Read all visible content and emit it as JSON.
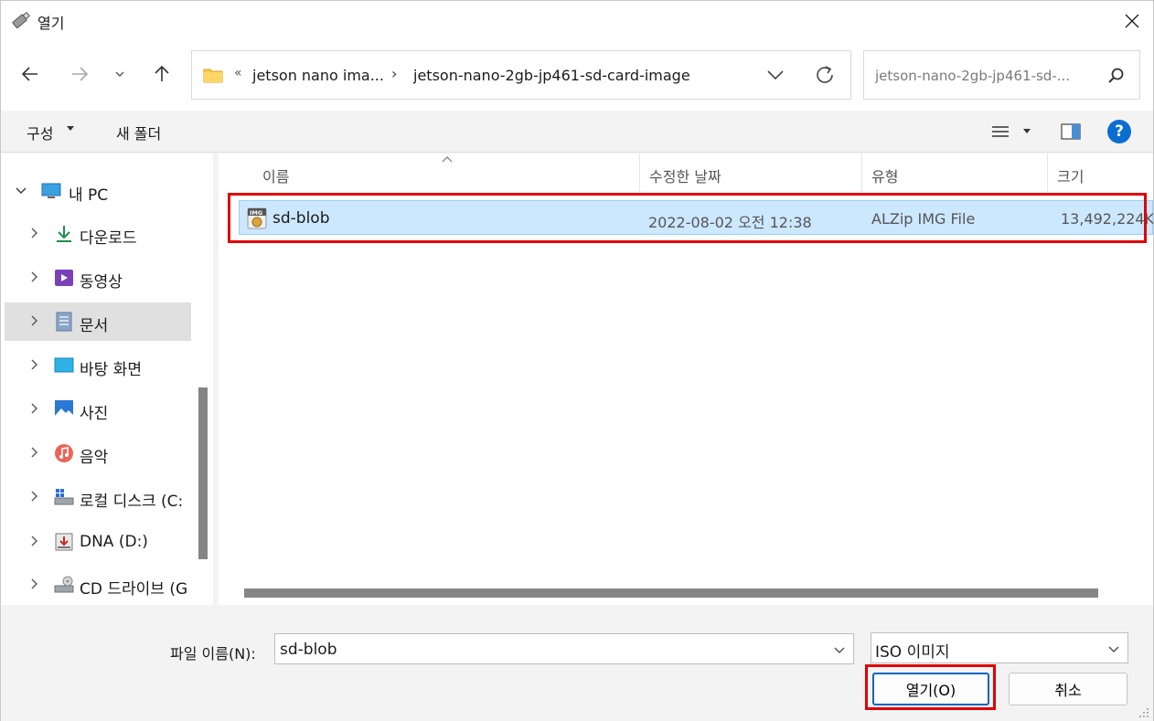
{
  "window": {
    "title": "열기"
  },
  "address": {
    "overflow_glyph": "«",
    "crumbs": [
      "jetson nano ima...",
      "jetson-nano-2gb-jp461-sd-card-image"
    ],
    "separator": "›"
  },
  "search": {
    "placeholder": "jetson-nano-2gb-jp461-sd-..."
  },
  "toolbar": {
    "organize_label": "구성",
    "new_folder_label": "새 폴더",
    "help_label": "?"
  },
  "sidebar": {
    "items": [
      {
        "label": "내 PC",
        "icon": "computer-icon",
        "expanded": true
      },
      {
        "label": "다운로드",
        "icon": "download-icon"
      },
      {
        "label": "동영상",
        "icon": "video-icon"
      },
      {
        "label": "문서",
        "icon": "document-icon",
        "selected": true
      },
      {
        "label": "바탕 화면",
        "icon": "desktop-icon"
      },
      {
        "label": "사진",
        "icon": "pictures-icon"
      },
      {
        "label": "음악",
        "icon": "music-icon"
      },
      {
        "label": "로컬 디스크 (C:",
        "icon": "local-disk-icon"
      },
      {
        "label": "DNA (D:)",
        "icon": "drive-icon"
      },
      {
        "label": "CD 드라이브 (G",
        "icon": "cd-drive-icon"
      }
    ]
  },
  "columns": {
    "name": "이름",
    "modified": "수정한 날짜",
    "type": "유형",
    "size": "크기"
  },
  "files": [
    {
      "name": "sd-blob",
      "modified": "2022-08-02 오전 12:38",
      "type": "ALZip IMG File",
      "size": "13,492,224K",
      "icon": "img-file-icon",
      "selected": true
    }
  ],
  "bottom": {
    "filename_label": "파일 이름(N):",
    "filename_value": "sd-blob",
    "filetype_value": "ISO 이미지",
    "open_label": "열기(O)",
    "cancel_label": "취소"
  },
  "colors": {
    "selection_bg": "#cce8ff",
    "selection_border": "#99d1ff",
    "highlight_red": "#e00000",
    "accent_blue": "#0067c0"
  }
}
